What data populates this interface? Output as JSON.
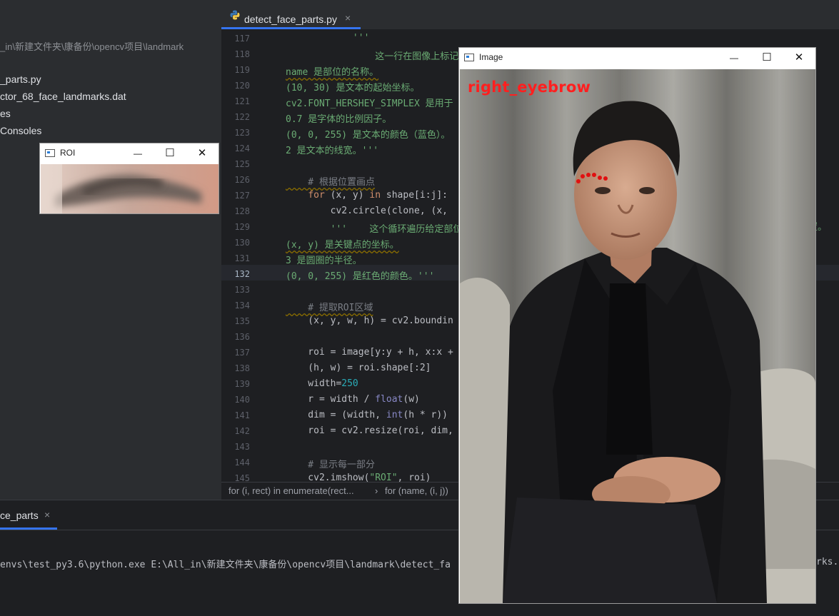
{
  "project": {
    "items": [
      {
        "label": "_in\\新建文件夹\\康备份\\opencv项目\\landmark",
        "muted": true
      },
      {
        "label": "_parts.py"
      },
      {
        "label": "ctor_68_face_landmarks.dat"
      },
      {
        "label": "es"
      },
      {
        "label": "Consoles"
      }
    ]
  },
  "editor": {
    "tab": {
      "filename": "detect_face_parts.py",
      "close": "×"
    },
    "current_line": 132,
    "lines": [
      {
        "n": 117,
        "segs": [
          {
            "t": "            '''",
            "c": "green"
          }
        ]
      },
      {
        "n": 118,
        "segs": [
          {
            "t": "                这一行在图像上标记面部部位的",
            "c": "green"
          }
        ]
      },
      {
        "n": 119,
        "segs": [
          {
            "t": "name 是部位的名称。",
            "c": "green",
            "w": true
          }
        ]
      },
      {
        "n": 120,
        "segs": [
          {
            "t": "(10, 30) 是文本的起始坐标。",
            "c": "green"
          }
        ]
      },
      {
        "n": 121,
        "segs": [
          {
            "t": "cv2.FONT_HERSHEY_SIMPLEX 是用于",
            "c": "green"
          }
        ]
      },
      {
        "n": 122,
        "segs": [
          {
            "t": "0.7 是字体的比例因子。",
            "c": "green"
          }
        ]
      },
      {
        "n": 123,
        "segs": [
          {
            "t": "(0, 0, 255) 是文本的颜色（蓝色）。",
            "c": "green"
          }
        ]
      },
      {
        "n": 124,
        "segs": [
          {
            "t": "2 是文本的线宽。'''",
            "c": "green"
          }
        ]
      },
      {
        "n": 125,
        "segs": []
      },
      {
        "n": 126,
        "segs": [
          {
            "t": "    # 根据位置画点",
            "c": "cmt",
            "w": true
          }
        ]
      },
      {
        "n": 127,
        "segs": [
          {
            "t": "    ",
            "c": ""
          },
          {
            "t": "for",
            "c": "kw"
          },
          {
            "t": " (x, y) ",
            "c": ""
          },
          {
            "t": "in",
            "c": "kw"
          },
          {
            "t": " shape[i:j]:",
            "c": ""
          }
        ]
      },
      {
        "n": 128,
        "segs": [
          {
            "t": "        cv2.circle(clone, (x, ",
            "c": ""
          }
        ]
      },
      {
        "n": 129,
        "segs": [
          {
            "t": "        '''    这个循环遍历给定部位",
            "c": "green"
          }
        ]
      },
      {
        "n": 130,
        "segs": [
          {
            "t": "(x, y) 是关键点的坐标。",
            "c": "green",
            "w": true
          }
        ]
      },
      {
        "n": 131,
        "segs": [
          {
            "t": "3 是圆圈的半径。",
            "c": "green"
          }
        ]
      },
      {
        "n": 132,
        "segs": [
          {
            "t": "(0, 0, 255) 是红色的颜色。'''",
            "c": "green"
          }
        ]
      },
      {
        "n": 133,
        "segs": []
      },
      {
        "n": 134,
        "segs": [
          {
            "t": "    # 提取ROI区域",
            "c": "cmt",
            "w": true
          }
        ]
      },
      {
        "n": 135,
        "segs": [
          {
            "t": "    (x, y, w, h) = cv2.boundin",
            "c": ""
          }
        ]
      },
      {
        "n": 136,
        "segs": []
      },
      {
        "n": 137,
        "segs": [
          {
            "t": "    roi = image[y:y + h, x:x +",
            "c": ""
          }
        ]
      },
      {
        "n": 138,
        "segs": [
          {
            "t": "    (h, w) = roi.shape[:2]",
            "c": ""
          }
        ]
      },
      {
        "n": 139,
        "segs": [
          {
            "t": "    width=",
            "c": ""
          },
          {
            "t": "250",
            "c": "num"
          }
        ]
      },
      {
        "n": 140,
        "segs": [
          {
            "t": "    r = width / ",
            "c": ""
          },
          {
            "t": "float",
            "c": "bi"
          },
          {
            "t": "(w)",
            "c": ""
          }
        ]
      },
      {
        "n": 141,
        "segs": [
          {
            "t": "    dim = (width, ",
            "c": ""
          },
          {
            "t": "int",
            "c": "bi"
          },
          {
            "t": "(h * r))",
            "c": ""
          }
        ]
      },
      {
        "n": 142,
        "segs": [
          {
            "t": "    roi = cv2.resize(roi, dim,",
            "c": ""
          }
        ]
      },
      {
        "n": 143,
        "segs": []
      },
      {
        "n": 144,
        "segs": [
          {
            "t": "    # 显示每一部分",
            "c": "cmt"
          }
        ]
      },
      {
        "n": 145,
        "segs": [
          {
            "t": "    cv2.imshow(",
            "c": ""
          },
          {
            "t": "\"ROI\"",
            "c": "str"
          },
          {
            "t": ", roi)",
            "c": ""
          }
        ]
      }
    ],
    "line129_tail": "置。"
  },
  "breadcrumb": {
    "item1": "for (i, rect) in enumerate(rect...",
    "sep": "›",
    "item2": "for (name, (i, j))"
  },
  "run": {
    "tab_label": "ce_parts",
    "tab_close": "×",
    "command": "envs\\test_py3.6\\python.exe E:\\All_in\\新建文件夹\\康备份\\opencv项目\\landmark\\detect_fa",
    "command_tail": "rks.d"
  },
  "roi_window": {
    "title": "ROI",
    "minimize": "—",
    "maximize": "☐",
    "close": "✕"
  },
  "image_window": {
    "title": "Image",
    "minimize": "—",
    "maximize": "☐",
    "close": "✕",
    "overlay_label": "right_eyebrow",
    "landmark_color": "#e01010"
  }
}
